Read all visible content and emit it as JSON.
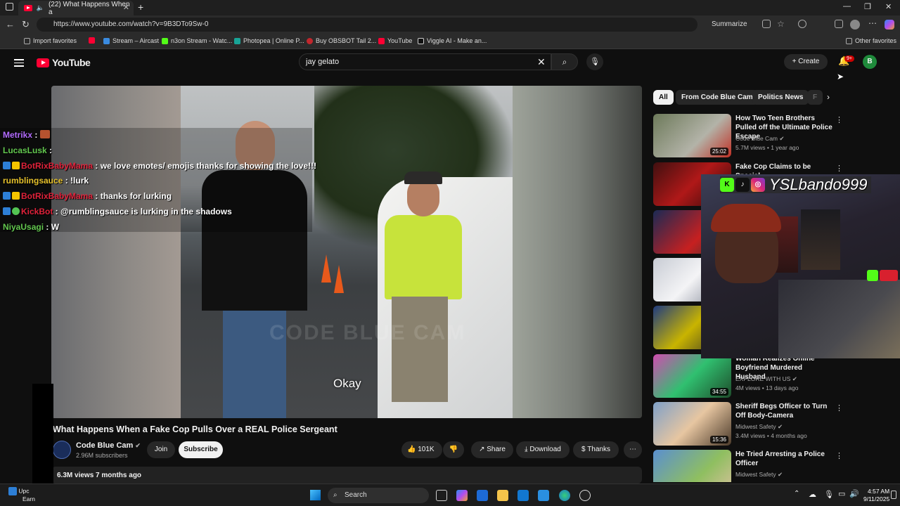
{
  "browser": {
    "tab_title": "(22) What Happens When a",
    "url": "https://www.youtube.com/watch?v=9B3DTo9Sw-0",
    "summarize": "Summarize",
    "bookmarks": [
      "Import favorites",
      "Stream – Aircast",
      "n3on Stream - Watc...",
      "Photopea | Online P...",
      "Buy OBSBOT Tail 2...",
      "YouTube",
      "Viggle AI - Make an..."
    ],
    "other_favorites": "Other favorites"
  },
  "youtube": {
    "logo": "YouTube",
    "search_value": "jay gelato",
    "create": "Create",
    "notif_badge": "9+",
    "avatar_letter": "B"
  },
  "video": {
    "caption": "Okay",
    "watermark": "CODE BLUE CAM",
    "title": "What Happens When a Fake Cop Pulls Over a REAL Police Sergeant",
    "channel": "Code Blue Cam",
    "subscribers": "2.96M subscribers",
    "join": "Join",
    "subscribe": "Subscribe",
    "likes": "101K",
    "share": "Share",
    "download": "Download",
    "thanks": "Thanks",
    "views_line": "6.3M views  7 months ago"
  },
  "chat": [
    {
      "user": "Metrikx",
      "msg": "",
      "color": "#b36cff"
    },
    {
      "user": "LucasLusk",
      "msg": "",
      "color": "#63c84f"
    },
    {
      "user": "BotRixBabyMama",
      "msg": "we love emotes/ emojis thanks for showing the love!!!",
      "color": "#e0223a"
    },
    {
      "user": "rumblingsauce",
      "msg": "!lurk",
      "color": "#e6c12b"
    },
    {
      "user": "BotRixBabyMama",
      "msg": "thanks for lurking",
      "color": "#e0223a"
    },
    {
      "user": "KickBot",
      "msg": "@rumblingsauce is lurking in the shadows",
      "color": "#e0223a"
    },
    {
      "user": "NiyaUsagi",
      "msg": "W",
      "color": "#63c84f"
    }
  ],
  "chips": [
    "All",
    "From Code Blue Cam",
    "Politics News",
    "F"
  ],
  "recommendations": [
    {
      "title": "How Two Teen Brothers Pulled off the Ultimate Police Escape",
      "channel": "Code Blue Cam",
      "meta": "5.7M views • 1 year ago",
      "duration": "25:02"
    },
    {
      "title": "Fake Cop Claims to be Special",
      "channel": "",
      "meta": "",
      "duration": ""
    },
    {
      "title": "",
      "channel": "",
      "meta": "",
      "duration": ""
    },
    {
      "title": "",
      "channel": "",
      "meta": "",
      "duration": ""
    },
    {
      "title": "",
      "channel": "",
      "meta": "",
      "duration": ""
    },
    {
      "title": "Woman Realizes Online Boyfriend Murdered Husband",
      "channel": "EXPLORE WITH US",
      "meta": "4M views • 13 days ago",
      "duration": "34:55"
    },
    {
      "title": "Sheriff Begs Officer to Turn Off Body-Camera",
      "channel": "Midwest Safety",
      "meta": "3.4M views • 4 months ago",
      "duration": "15:36"
    },
    {
      "title": "He Tried Arresting a Police Officer",
      "channel": "Midwest Safety",
      "meta": "",
      "duration": ""
    }
  ],
  "webcam": {
    "handle": "YSLbando999"
  },
  "taskbar": {
    "search": "Search",
    "time": "4:57 AM",
    "date": "9/11/2025",
    "left_text": "Upc",
    "left_text2": "Earn"
  }
}
